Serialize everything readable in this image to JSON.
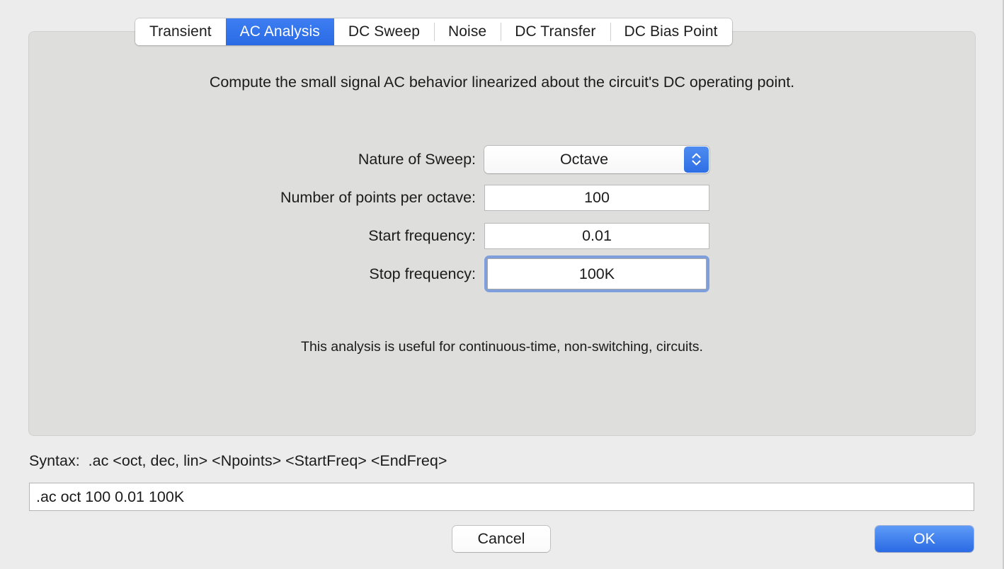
{
  "tabs": [
    {
      "label": "Transient",
      "active": false
    },
    {
      "label": "AC Analysis",
      "active": true
    },
    {
      "label": "DC Sweep",
      "active": false
    },
    {
      "label": "Noise",
      "active": false
    },
    {
      "label": "DC Transfer",
      "active": false
    },
    {
      "label": "DC Bias Point",
      "active": false
    }
  ],
  "panel": {
    "description": "Compute the small signal AC behavior linearized about the circuit's DC operating point.",
    "note": "This analysis is useful for continuous-time, non-switching, circuits."
  },
  "form": {
    "nature_of_sweep": {
      "label": "Nature of Sweep:",
      "value": "Octave",
      "stepper_icon": "stepper-up-down-icon"
    },
    "points_per_octave": {
      "label": "Number of points per octave:",
      "value": "100"
    },
    "start_frequency": {
      "label": "Start frequency:",
      "value": "0.01"
    },
    "stop_frequency": {
      "label": "Stop frequency:",
      "value": "100K",
      "focused": true
    }
  },
  "syntax": {
    "text": "Syntax:  .ac <oct, dec, lin> <Npoints> <StartFreq> <EndFreq>"
  },
  "command": {
    "value": ".ac oct 100 0.01 100K"
  },
  "footer": {
    "cancel_label": "Cancel",
    "ok_label": "OK"
  },
  "colors": {
    "accent_blue": "#2f6fe8",
    "focus_ring": "#7e9fdc",
    "panel_bg": "#dededd",
    "window_bg": "#ececec"
  }
}
